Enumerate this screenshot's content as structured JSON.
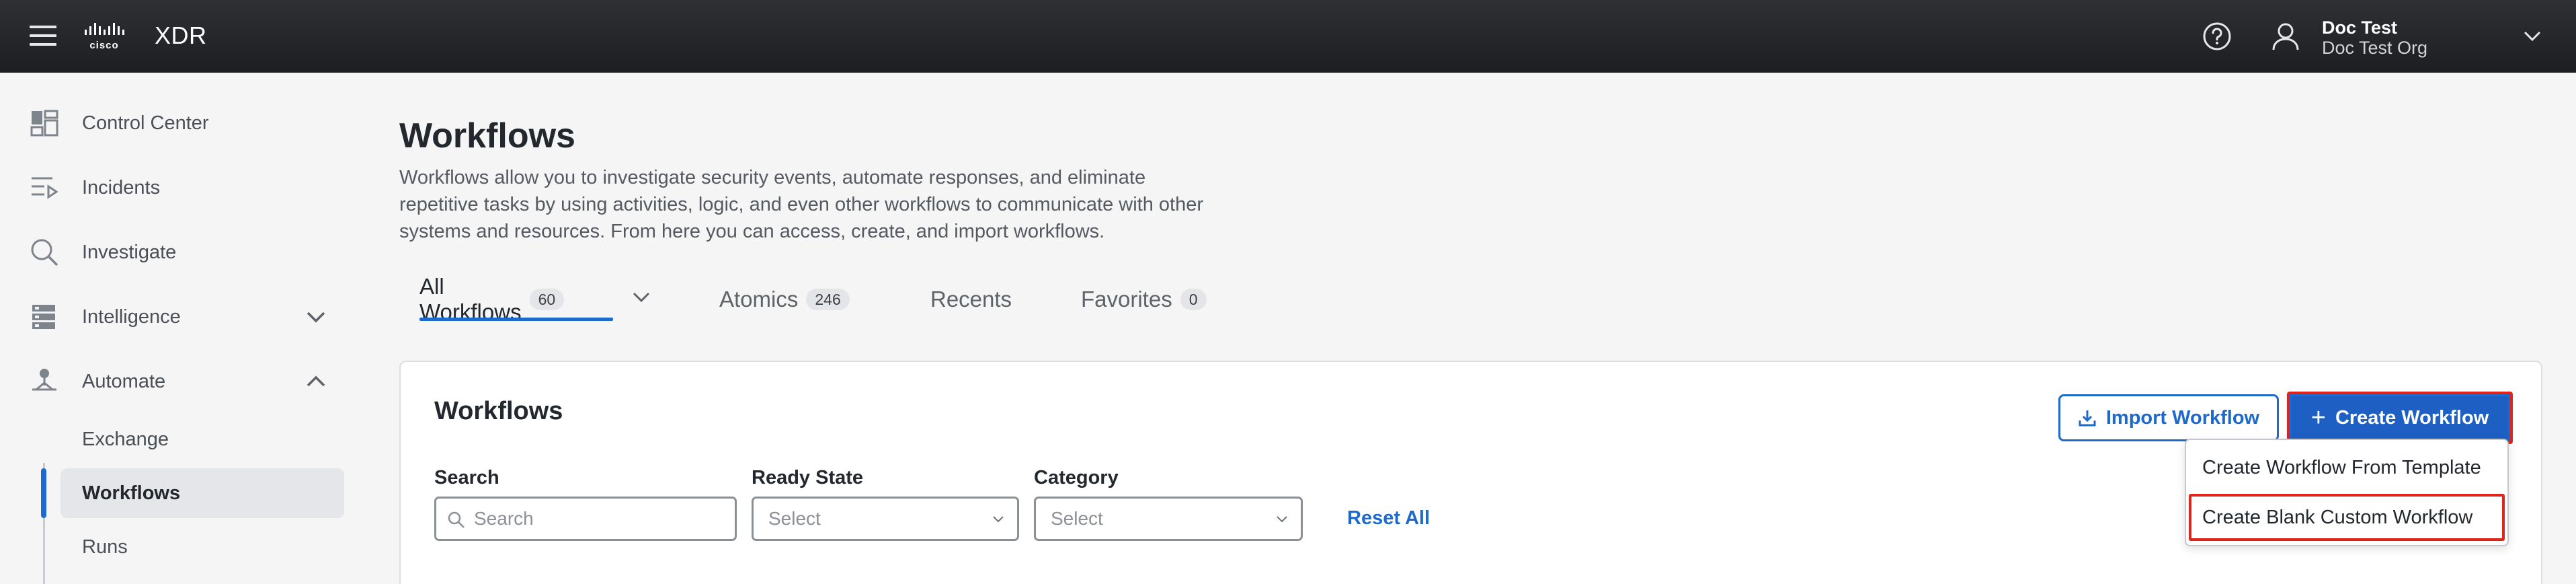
{
  "header": {
    "product": "XDR",
    "brand_logo": "cisco",
    "user_name": "Doc Test",
    "user_org": "Doc Test Org"
  },
  "sidebar": {
    "items": [
      {
        "label": "Control Center",
        "icon": "dashboard-icon"
      },
      {
        "label": "Incidents",
        "icon": "incidents-icon"
      },
      {
        "label": "Investigate",
        "icon": "search-icon"
      },
      {
        "label": "Intelligence",
        "icon": "database-icon"
      },
      {
        "label": "Automate",
        "icon": "automate-icon"
      }
    ],
    "subitems": [
      {
        "label": "Exchange"
      },
      {
        "label": "Workflows",
        "active": true
      },
      {
        "label": "Runs"
      }
    ]
  },
  "page": {
    "title": "Workflows",
    "description": "Workflows allow you to investigate security events, automate responses, and eliminate repetitive tasks by using activities, logic, and even other workflows to communicate with other systems and resources. From here you can access, create, and import workflows."
  },
  "tabs": [
    {
      "label": "All Workflows",
      "count": "60",
      "active": true
    },
    {
      "label": "Atomics",
      "count": "246"
    },
    {
      "label": "Recents",
      "count": ""
    },
    {
      "label": "Favorites",
      "count": "0"
    }
  ],
  "card": {
    "title": "Workflows",
    "import_label": "Import Workflow",
    "create_label": "Create Workflow",
    "filters": {
      "search_label": "Search",
      "search_placeholder": "Search",
      "ready_state_label": "Ready State",
      "ready_state_value": "Select",
      "category_label": "Category",
      "category_value": "Select"
    },
    "reset_label": "Reset All"
  },
  "dropdown": {
    "items": [
      {
        "label": "Create Workflow From Template"
      },
      {
        "label": "Create Blank Custom Workflow",
        "highlighted": true
      }
    ]
  },
  "colors": {
    "accent": "#1d69cc",
    "highlight_border": "#e2231a",
    "header_bg": "#1c1e21"
  }
}
